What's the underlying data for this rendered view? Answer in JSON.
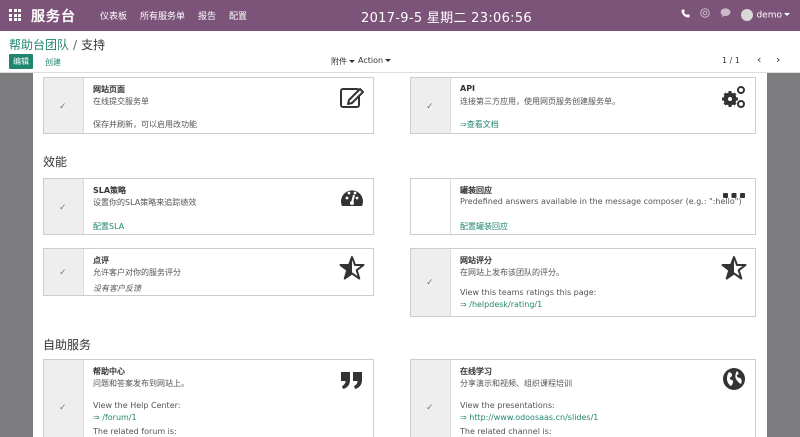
{
  "topbar": {
    "brand": "服务台",
    "menu": [
      "仪表板",
      "所有服务单",
      "报告",
      "配置"
    ],
    "datetime": "2017-9-5   星期二   23:06:56",
    "user": "demo"
  },
  "breadcrumb": {
    "parent": "帮助台团队",
    "separator": "/",
    "current": "支持"
  },
  "buttons": {
    "edit": "编辑",
    "create": "创建",
    "attachment": "附件",
    "action": "Action"
  },
  "pager": {
    "value": "1 / 1"
  },
  "sections": {
    "efficiency": "效能",
    "self_service": "自助服务"
  },
  "cards": {
    "website_form": {
      "title": "网站页面",
      "desc": "在线提交服务单",
      "note": "保存并刷新，可以启用改功能"
    },
    "api": {
      "title": "API",
      "desc": "连接第三方应用，使用网页服务创建服务单。",
      "link": "⇒查看文档"
    },
    "sla": {
      "title": "SLA策略",
      "desc": "设置你的SLA策略来追踪绩效",
      "link": "配置SLA"
    },
    "canned": {
      "title": "罐装回应",
      "desc": "Predefined answers available in the message composer (e.g.: \":hello\")",
      "link": "配置罐装回应"
    },
    "rating": {
      "title": "点评",
      "desc": "允许客户对你的服务评分",
      "note": "没有客户反馈"
    },
    "website_rating": {
      "title": "网站评分",
      "desc": "在网站上发布该团队的评分。",
      "line1": "View this teams ratings this page:",
      "link": "⇒ /helpdesk/rating/1"
    },
    "help_center": {
      "title": "帮助中心",
      "desc": "问题和答案发布到网站上。",
      "line1": "View the Help Center:",
      "link": "⇒ /forum/1",
      "line2": "The related forum is:"
    },
    "elearning": {
      "title": "在线学习",
      "desc": "分享演示和视频、组织课程培训",
      "line1": "View the presentations:",
      "link": "⇒ http://www.odoosaas.cn/slides/1",
      "line2": "The related channel is:"
    }
  },
  "icons": {
    "apps": "apps-grid-icon",
    "phone": "phone-icon",
    "help": "help-icon",
    "chat": "chat-icon"
  },
  "colors": {
    "topbar": "#7c5379",
    "accent": "#21866f"
  }
}
